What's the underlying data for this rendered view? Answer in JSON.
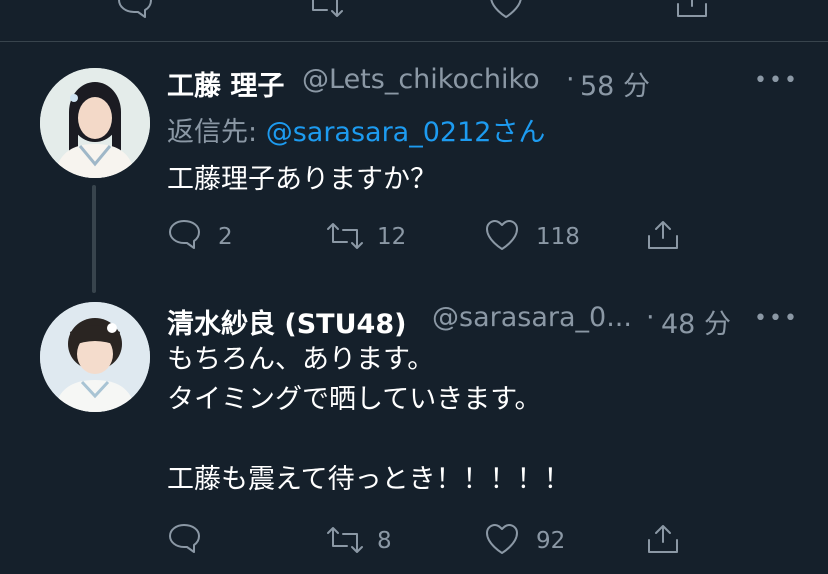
{
  "tweets": [
    {
      "display_name": "工藤 理子",
      "handle": "@Lets_chikochiko",
      "separator": "·",
      "time": "58 分",
      "reply_prefix": "返信先:",
      "reply_mention": "@sarasara_0212",
      "reply_suffix": "さん",
      "text": "工藤理子ありますか？",
      "replies": "2",
      "retweets": "12",
      "likes": "118"
    },
    {
      "display_name": "清水紗良 (STU48)",
      "handle": "@sarasara_0...",
      "separator": "·",
      "time": "48 分",
      "text": "もちろん、あります。\nタイミングで晒していきます。\n\n工藤も震えて待っとき！！！！！",
      "replies": "",
      "retweets": "8",
      "likes": "92"
    }
  ],
  "icons": {
    "reply": "reply-icon",
    "retweet": "retweet-icon",
    "like": "heart-icon",
    "share": "share-icon",
    "more": "more-options-icon"
  },
  "colors": {
    "background": "#15202b",
    "secondary_text": "#8b98a5",
    "link": "#1d9bf0",
    "divider": "#38444d"
  }
}
